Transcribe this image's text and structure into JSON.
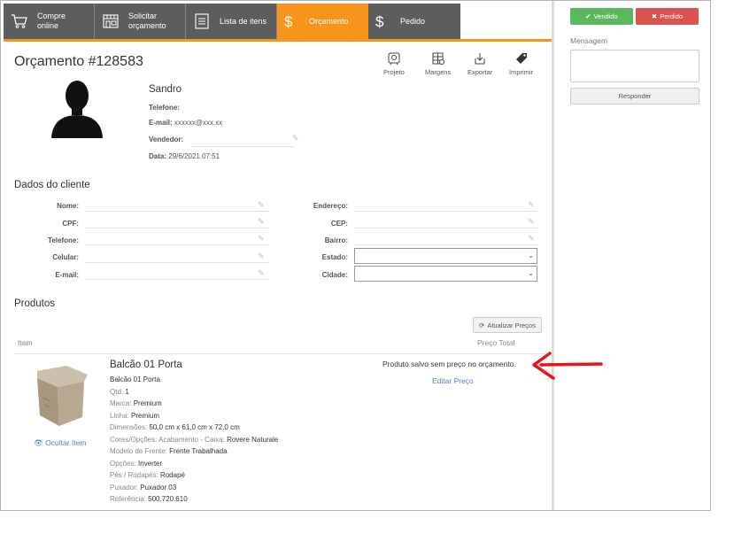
{
  "tabs": [
    {
      "label_1": "Compre",
      "label_2": "online",
      "icon": "cart-icon"
    },
    {
      "label_1": "Solicitar",
      "label_2": "orçamento",
      "icon": "store-icon"
    },
    {
      "label_1": "Lista de itens",
      "icon": "list-icon"
    },
    {
      "label_1": "Orçamento",
      "icon": "dollar-icon",
      "active": true
    },
    {
      "label_1": "Pedido",
      "icon": "dollar-icon"
    }
  ],
  "colors": {
    "accent": "#f7941d",
    "tab_bg": "#5d5d5d",
    "success": "#5cb85c",
    "danger": "#d9534f",
    "link": "#4b84c6",
    "arrow": "#e8151b"
  },
  "header": {
    "title": "Orçamento #128583",
    "tools": [
      "Projeto",
      "Margens",
      "Exportar",
      "Imprimir"
    ]
  },
  "contact": {
    "name": "Sandro",
    "telefone_label": "Telefone:",
    "email_label": "E-mail:",
    "email_value": "xxxxxx@xxx.xx",
    "vendedor_label": "Vendedor:",
    "data_label": "Data:",
    "data_value": "29/6/2021 07:51"
  },
  "client_section": {
    "title": "Dados do cliente",
    "left_fields": [
      "Nome:",
      "CPF:",
      "Telefone:",
      "Celular:",
      "E-mail:"
    ],
    "right_fields": [
      "Endereço:",
      "CEP:",
      "Bairro:",
      "Estado:",
      "Cidade:"
    ]
  },
  "products": {
    "title": "Produtos",
    "update_button": "Atualizar Preços",
    "col_item": "Item",
    "col_price": "Preço Total",
    "hide_item": "Ocultar Item",
    "item": {
      "name": "Balcão 01 Porta",
      "subname": "Balcão 01 Porta",
      "qtd_label": "Qtd:",
      "qtd": "1",
      "marca_label": "Marca:",
      "marca": "Premium",
      "linha_label": "Linha:",
      "linha": "Premium",
      "dim_label": "Dimensões:",
      "dim": "50,0 cm x 61,0 cm x 72,0 cm",
      "cores_label": "Cores/Opções: Acabamento - Caixa:",
      "cores": "Rovere Naturale",
      "frente_label": "Modelo de Frente:",
      "frente": "Frente Trabalhada",
      "opcoes_label": "Opções:",
      "opcoes": "Inverter",
      "pes_label": "Pés / Rodapés:",
      "pes": "Rodapé",
      "puxador_label": "Puxador:",
      "puxador": "Puxador 03",
      "ref_label": "Referência:",
      "ref": "500.720.610"
    },
    "price_message": "Produto salvo sem preço no orçamento.",
    "edit_price": "Editar Preço"
  },
  "right_panel": {
    "vendido": "Vendido",
    "perdido": "Perdido",
    "message_label": "Mensagem",
    "message_value": "",
    "responder": "Responder"
  }
}
